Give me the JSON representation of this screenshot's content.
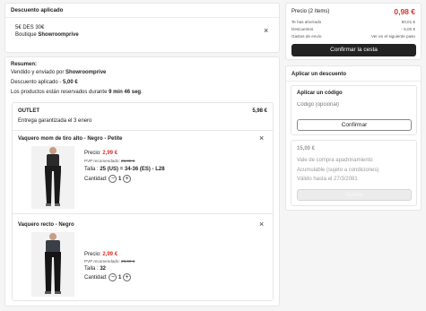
{
  "applied": {
    "heading": "Descuento aplicado",
    "code_line": "5€ DES 30€",
    "store_prefix": "Boutique ",
    "store_name": "Showroomprive"
  },
  "summary": {
    "heading": "Resumen:",
    "sold_prefix": "Vendido y enviado por ",
    "sold_by": "Showroomprive",
    "discount_prefix": "Descuento aplicado - ",
    "discount_value": "5,00 €",
    "reserved_prefix": "Los productos están reservados durante ",
    "reserved_time": "9 min 46 seg",
    "reserved_suffix": "."
  },
  "outlet": {
    "title": "OUTLET",
    "price": "5,98 €",
    "delivery": "Entrega garantizada el 3 enero"
  },
  "products": [
    {
      "title": "Vaquero mom de tiro alto - Negro - Petite",
      "price_label": "Precio: ",
      "price": "2,99 €",
      "pvp_label": "PVP recomendado: ",
      "pvp": "25,99 €",
      "size_label": "Talla : ",
      "size": "25 (US) = 34-36 (ES) - L28",
      "qty_label": "Cantidad:",
      "qty": "1"
    },
    {
      "title": "Vaquero recto - Negro",
      "price_label": "Precio: ",
      "price": "2,99 €",
      "pvp_label": "PVP recomendado: ",
      "pvp": "29,99 €",
      "size_label": "Talla : ",
      "size": "32",
      "qty_label": "Cantidad:",
      "qty": "1"
    }
  ],
  "totals": {
    "price_label": "Precio (2 ítems)",
    "price_value": "0,98 €",
    "saved_label": "Te has ahorrado",
    "saved_value": "50,01 €",
    "discounts_label": "Descuentos",
    "discounts_value": "- 5,00 €",
    "shipping_label": "Gastos de envío",
    "shipping_value": "Ver en el siguiente paso",
    "confirm_button": "Confirmar la cesta"
  },
  "discount_box": {
    "heading": "Aplicar un descuento",
    "code_heading": "Aplicar un código",
    "code_placeholder": "Código (opcional)",
    "confirm_button": "Confirmar",
    "sponsor_amount": "15,00 €",
    "sponsor_title": "Vale de compra apadrinamiento",
    "sponsor_note": "Acumulable (sujeto a condiciones)",
    "sponsor_valid": "Válido hasta el 27/3/2081",
    "apply_button": "Aplicar"
  },
  "colors": {
    "accent_red": "#e0302c",
    "dark_button": "#222222"
  },
  "icons": {
    "close": "×",
    "minus": "−",
    "plus": "+"
  }
}
